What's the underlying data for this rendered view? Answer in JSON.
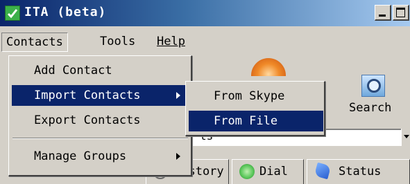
{
  "window": {
    "title": "ITA (beta)"
  },
  "menubar": {
    "contacts": "Contacts",
    "tools": "Tools",
    "help": "Help"
  },
  "contacts_menu": {
    "items": [
      {
        "label": "Add Contact"
      },
      {
        "label": "Import Contacts"
      },
      {
        "label": "Export Contacts"
      },
      {
        "label": "Manage Groups"
      }
    ]
  },
  "import_submenu": {
    "items": [
      {
        "label": "From Skype"
      },
      {
        "label": "From File"
      }
    ]
  },
  "toolbar": {
    "search_label": "Search",
    "dropdown_text": "ts"
  },
  "tabs": [
    {
      "label": "History"
    },
    {
      "label": "Dial"
    },
    {
      "label": "Status"
    }
  ],
  "colors": {
    "highlight": "#0a246a",
    "face": "#d4d0c8"
  },
  "icons": {
    "app": "ita-app-icon",
    "globe": "globe-icon",
    "search": "search-icon",
    "dial": "dial-icon",
    "status": "status-icon",
    "history": "history-icon"
  }
}
